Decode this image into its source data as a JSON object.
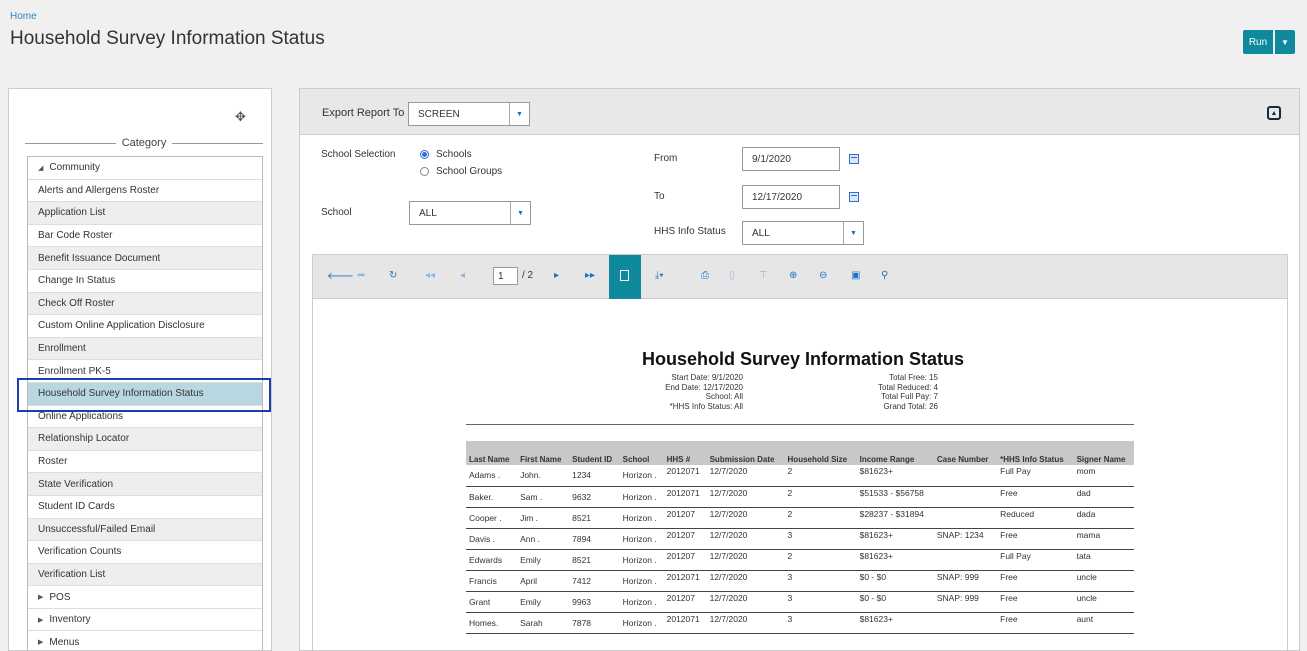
{
  "header": {
    "breadcrumb": "Home",
    "title": "Household Survey Information Status",
    "run_label": "Run"
  },
  "sidebar": {
    "category_label": "Category",
    "items": [
      {
        "label": "Community",
        "type": "group-open"
      },
      {
        "label": "Alerts and Allergens Roster"
      },
      {
        "label": "Application List"
      },
      {
        "label": "Bar Code Roster"
      },
      {
        "label": "Benefit Issuance Document"
      },
      {
        "label": "Change In Status"
      },
      {
        "label": "Check Off Roster"
      },
      {
        "label": "Custom Online Application Disclosure"
      },
      {
        "label": "Enrollment"
      },
      {
        "label": "Enrollment PK-5"
      },
      {
        "label": "Household Survey Information Status",
        "selected": true
      },
      {
        "label": "Online Applications"
      },
      {
        "label": "Relationship Locator"
      },
      {
        "label": "Roster"
      },
      {
        "label": "State Verification"
      },
      {
        "label": "Student ID Cards"
      },
      {
        "label": "Unsuccessful/Failed Email"
      },
      {
        "label": "Verification Counts"
      },
      {
        "label": "Verification List"
      },
      {
        "label": "POS",
        "type": "group-closed"
      },
      {
        "label": "Inventory",
        "type": "group-closed"
      },
      {
        "label": "Menus",
        "type": "group-closed"
      }
    ]
  },
  "filters": {
    "export_label": "Export Report To",
    "export_value": "SCREEN",
    "school_selection_label": "School Selection",
    "radio_schools": "Schools",
    "radio_school_groups": "School Groups",
    "school_label": "School",
    "school_value": "ALL",
    "from_label": "From",
    "from_value": "9/1/2020",
    "to_label": "To",
    "to_value": "12/17/2020",
    "hhs_label": "HHS Info Status",
    "hhs_value": "ALL"
  },
  "viewer": {
    "page_current": "1",
    "page_total": "/ 2"
  },
  "report": {
    "title": "Household Survey Information Status",
    "start_date": "Start Date: 9/1/2020",
    "end_date": "End Date: 12/17/2020",
    "school": "School: All",
    "hhs_status": "*HHS Info Status: All",
    "total_free": "Total Free: 15",
    "total_reduced": "Total Reduced: 4",
    "total_full": "Total Full Pay: 7",
    "grand_total": "Grand Total: 26",
    "columns": [
      "Last Name",
      "First Name",
      "Student ID",
      "School",
      "HHS #",
      "Submission Date",
      "Household Size",
      "Income Range",
      "Case Number",
      "*HHS Info Status",
      "Signer Name"
    ],
    "rows": [
      [
        "Adams .",
        "John.",
        "1234",
        "Horizon .",
        "2012071",
        "12/7/2020",
        "2",
        "$81623+",
        "",
        "Full Pay",
        "mom"
      ],
      [
        "Baker.",
        "Sam .",
        "9632",
        "Horizon .",
        "2012071",
        "12/7/2020",
        "2",
        "$51533 - $56758",
        "",
        "Free",
        "dad"
      ],
      [
        "Cooper .",
        "Jim .",
        "8521",
        "Horizon .",
        "201207",
        "12/7/2020",
        "2",
        "$28237 - $31894",
        "",
        "Reduced",
        "dada"
      ],
      [
        "Davis .",
        "Ann .",
        "7894",
        "Horizon .",
        "201207",
        "12/7/2020",
        "3",
        "$81623+",
        "SNAP: 1234",
        "Free",
        "mama"
      ],
      [
        "Edwards",
        "Emily",
        "8521",
        "Horizon .",
        "201207",
        "12/7/2020",
        "2",
        "$81623+",
        "",
        "Full Pay",
        "tata"
      ],
      [
        "Francis",
        "April",
        "7412",
        "Horizon .",
        "2012071",
        "12/7/2020",
        "3",
        "$0 - $0",
        "SNAP: 999",
        "Free",
        "uncle"
      ],
      [
        "Grant",
        "Emily",
        "9963",
        "Horizon .",
        "201207",
        "12/7/2020",
        "3",
        "$0 - $0",
        "SNAP: 999",
        "Free",
        "uncle"
      ],
      [
        "Homes.",
        "Sarah",
        "7878",
        "Horizon .",
        "2012071",
        "12/7/2020",
        "3",
        "$81623+",
        "",
        "Free",
        "aunt"
      ]
    ]
  }
}
